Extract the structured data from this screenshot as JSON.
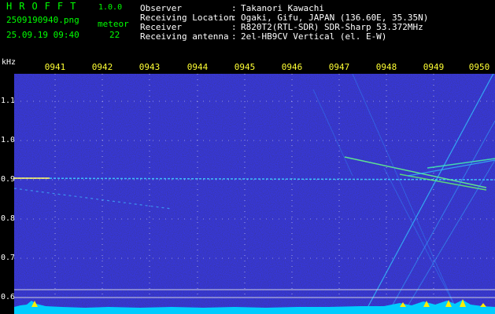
{
  "header": {
    "app_name": "HROFFT",
    "app_version": "1.0.0",
    "filename": "2509190940.png",
    "timestamp": "25.09.19 09:40",
    "meteor_label": "meteor",
    "meteor_count": "22",
    "info": [
      {
        "label": "Observer",
        "value": "Takanori Kawachi"
      },
      {
        "label": "Receiving Location",
        "value": "Ogaki, Gifu, JAPAN (136.60E, 35.35N)"
      },
      {
        "label": "Receiver",
        "value": "R820T2(RTL-SDR) SDR-Sharp 53.372MHz"
      },
      {
        "label": "Receiving antenna",
        "value": "2el-HB9CV Vertical (el. E-W)"
      }
    ]
  },
  "axes": {
    "unit": "kHz",
    "time_ticks": [
      "0941",
      "0942",
      "0943",
      "0944",
      "0945",
      "0946",
      "0947",
      "0948",
      "0949",
      "0950"
    ],
    "freq_ticks": [
      "1.1",
      "1.0",
      "0.9",
      "0.8",
      "0.7",
      "0.6"
    ]
  },
  "colors": {
    "background": "#000000",
    "spectrogram_base": "#0a0a6e",
    "header_green": "#00ff00",
    "tick_yellow": "#ffff33",
    "trace_cyan": "#33ccff",
    "noise_floor": "#00ccff"
  }
}
